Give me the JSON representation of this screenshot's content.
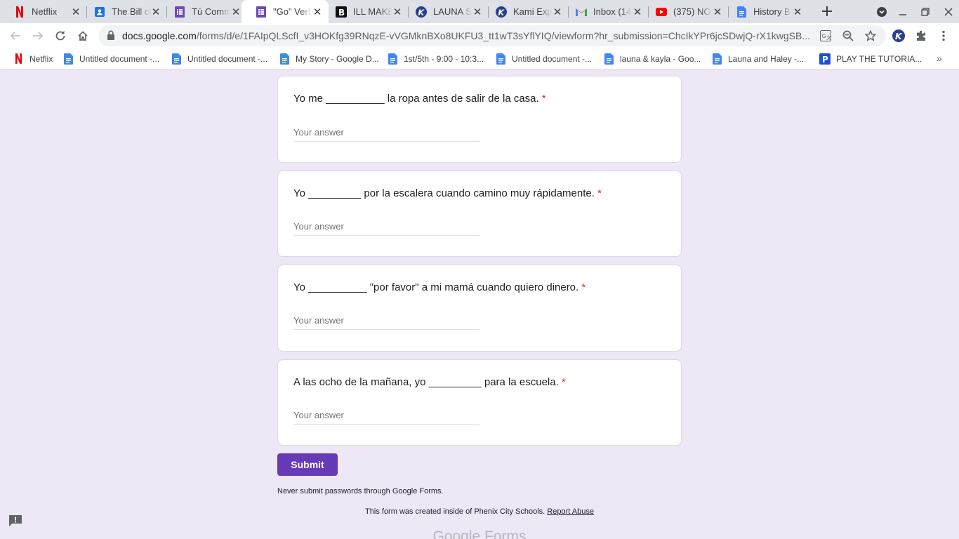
{
  "browser": {
    "tabs": [
      {
        "title": "Netflix",
        "icon": "netflix-icon"
      },
      {
        "title": "The Bill of Rights",
        "icon": "contacts-icon"
      },
      {
        "title": "Tú Commands",
        "icon": "forms-icon"
      },
      {
        "title": "\"Go\" Verbs",
        "icon": "forms-icon"
      },
      {
        "title": "ILL MAKE",
        "icon": "b-icon"
      },
      {
        "title": "LAUNA S",
        "icon": "kami-icon"
      },
      {
        "title": "Kami Export",
        "icon": "kami-icon"
      },
      {
        "title": "Inbox (14",
        "icon": "gmail-icon"
      },
      {
        "title": "(375) NO",
        "icon": "youtube-icon"
      },
      {
        "title": "History B",
        "icon": "docs-icon"
      }
    ],
    "url_host": "docs.google.com",
    "url_path": "/forms/d/e/1FAIpQLScfI_v3HOKfg39RNqzE-vVGMknBXo8UKFU3_tt1wT3sYflYIQ/viewform?hr_submission=ChcIkYPr6jcSDwjQ-rX1kwgSB..."
  },
  "bookmarks": [
    {
      "label": "Netflix",
      "icon": "netflix-icon"
    },
    {
      "label": "Untitled document -...",
      "icon": "docs-icon"
    },
    {
      "label": "Untitled document -...",
      "icon": "docs-icon"
    },
    {
      "label": "My Story - Google D...",
      "icon": "docs-icon"
    },
    {
      "label": "1st/5th - 9:00 - 10:3...",
      "icon": "docs-icon"
    },
    {
      "label": "Untitled document -...",
      "icon": "docs-icon"
    },
    {
      "label": "launa & kayla - Goo...",
      "icon": "docs-icon"
    },
    {
      "label": "Launa and Haley -...",
      "icon": "docs-icon"
    },
    {
      "label": "PLAY THE TUTORIA...",
      "icon": "p-icon"
    }
  ],
  "form": {
    "questions": [
      {
        "text": "Yo me __________ la ropa antes de salir de la casa.",
        "required_mark": "*",
        "placeholder": "Your answer"
      },
      {
        "text": "Yo _________ por la escalera cuando camino muy rápidamente.",
        "required_mark": "*",
        "placeholder": "Your answer"
      },
      {
        "text": "Yo __________ \"por favor\" a mi mamá cuando quiero dinero.",
        "required_mark": "*",
        "placeholder": "Your answer"
      },
      {
        "text": "A las ocho de la mañana, yo _________ para la escuela.",
        "required_mark": "*",
        "placeholder": "Your answer"
      }
    ],
    "submit_label": "Submit",
    "password_notice": "Never submit passwords through Google Forms.",
    "footer_text": "This form was created inside of Phenix City Schools.",
    "report_abuse": "Report Abuse",
    "logo_text": "Google Forms"
  },
  "colors": {
    "accent": "#673ab7",
    "background": "#ede7f6",
    "required": "#d93025"
  }
}
